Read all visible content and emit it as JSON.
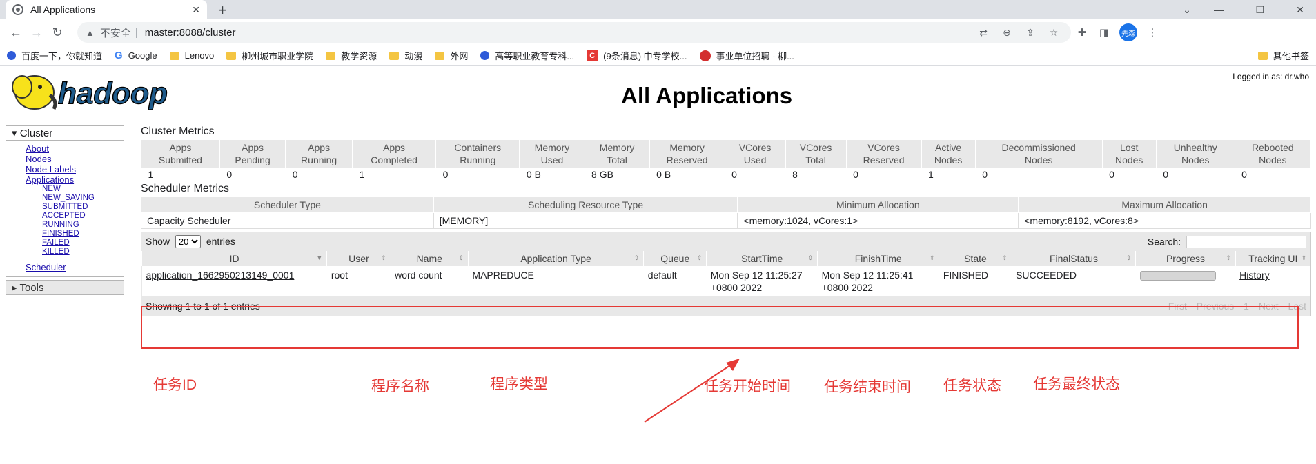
{
  "browser": {
    "tab_title": "All Applications",
    "insecure_label": "不安全",
    "url": "master:8088/cluster",
    "avatar_text": "先森",
    "bookmarks": [
      {
        "label": "百度一下，你就知道",
        "icon": "paw-icon"
      },
      {
        "label": "Google",
        "icon": "google-icon"
      },
      {
        "label": "Lenovo",
        "icon": "folder-icon"
      },
      {
        "label": "柳州城市职业学院",
        "icon": "folder-icon"
      },
      {
        "label": "教学资源",
        "icon": "folder-icon"
      },
      {
        "label": "动漫",
        "icon": "folder-icon"
      },
      {
        "label": "外网",
        "icon": "folder-icon"
      },
      {
        "label": "高等职业教育专科...",
        "icon": "paw-icon"
      },
      {
        "label": "(9条消息) 中专学校...",
        "icon": "csdn-icon"
      },
      {
        "label": "事业单位招聘 - 柳...",
        "icon": "seal-icon"
      }
    ],
    "other_bookmarks": "其他书签"
  },
  "page": {
    "logo_text": "hadoop",
    "title": "All Applications",
    "logged_in": "Logged in as: dr.who"
  },
  "sidebar": {
    "cluster_label": "Cluster",
    "links": [
      "About",
      "Nodes",
      "Node Labels",
      "Applications"
    ],
    "app_states": [
      "NEW",
      "NEW_SAVING",
      "SUBMITTED",
      "ACCEPTED",
      "RUNNING",
      "FINISHED",
      "FAILED",
      "KILLED"
    ],
    "scheduler": "Scheduler",
    "tools_label": "Tools"
  },
  "cluster_metrics": {
    "heading": "Cluster Metrics",
    "headers": [
      [
        "Apps",
        "Submitted"
      ],
      [
        "Apps",
        "Pending"
      ],
      [
        "Apps",
        "Running"
      ],
      [
        "Apps",
        "Completed"
      ],
      [
        "Containers",
        "Running"
      ],
      [
        "Memory",
        "Used"
      ],
      [
        "Memory",
        "Total"
      ],
      [
        "Memory",
        "Reserved"
      ],
      [
        "VCores",
        "Used"
      ],
      [
        "VCores",
        "Total"
      ],
      [
        "VCores",
        "Reserved"
      ],
      [
        "Active",
        "Nodes"
      ],
      [
        "Decommissioned",
        "Nodes"
      ],
      [
        "Lost",
        "Nodes"
      ],
      [
        "Unhealthy",
        "Nodes"
      ],
      [
        "Rebooted",
        "Nodes"
      ]
    ],
    "values": [
      "1",
      "0",
      "0",
      "1",
      "0",
      "0 B",
      "8 GB",
      "0 B",
      "0",
      "8",
      "0",
      "1",
      "0",
      "0",
      "0",
      "0"
    ]
  },
  "scheduler_metrics": {
    "heading": "Scheduler Metrics",
    "headers": [
      "Scheduler Type",
      "Scheduling Resource Type",
      "Minimum Allocation",
      "Maximum Allocation"
    ],
    "values": [
      "Capacity Scheduler",
      "[MEMORY]",
      "<memory:1024, vCores:1>",
      "<memory:8192, vCores:8>"
    ]
  },
  "apps": {
    "show_label": "Show",
    "page_size": "20",
    "entries_label": "entries",
    "search_label": "Search:",
    "headers": [
      "ID",
      "User",
      "Name",
      "Application Type",
      "Queue",
      "StartTime",
      "FinishTime",
      "State",
      "FinalStatus",
      "Progress",
      "Tracking UI"
    ],
    "rows": [
      {
        "id": "application_1662950213149_0001",
        "user": "root",
        "name": "word count",
        "type": "MAPREDUCE",
        "queue": "default",
        "start1": "Mon Sep 12 11:25:27",
        "start2": "+0800 2022",
        "finish1": "Mon Sep 12 11:25:41",
        "finish2": "+0800 2022",
        "state": "FINISHED",
        "final": "SUCCEEDED",
        "progress": 1.0,
        "tracking": "History"
      }
    ],
    "showing": "Showing 1 to 1 of 1 entries",
    "pager": [
      "First",
      "Previous",
      "1",
      "Next",
      "Last"
    ]
  },
  "annotations": {
    "task_id": "任务ID",
    "program_name": "程序名称",
    "program_type": "程序类型",
    "start_time": "任务开始时间",
    "end_time": "任务结束时间",
    "state": "任务状态",
    "final_state": "任务最终状态"
  },
  "colors": {
    "annotation": "#e53935",
    "header_bg": "#e8e8e8"
  }
}
